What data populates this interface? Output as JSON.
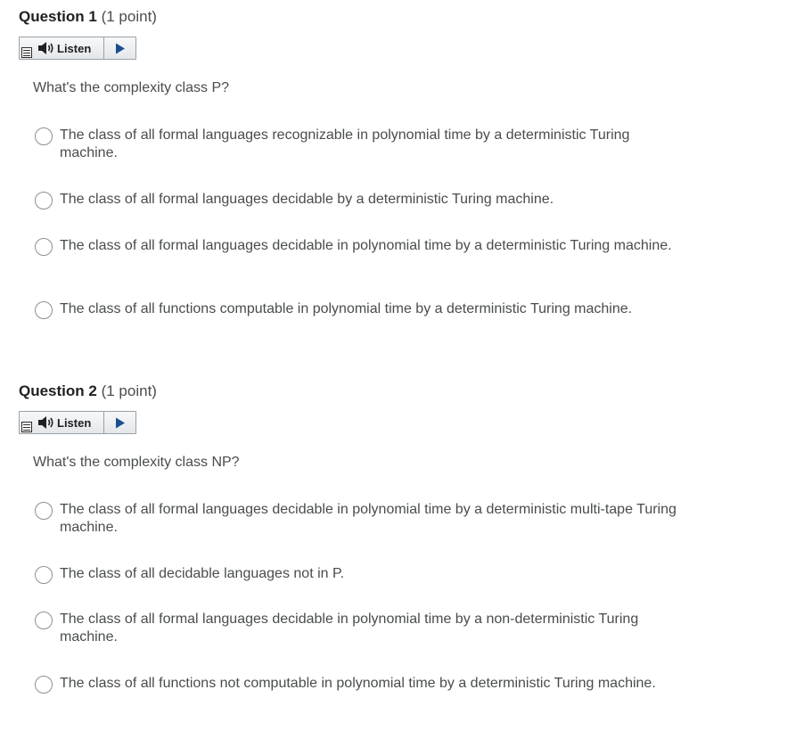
{
  "questions": [
    {
      "title": "Question 1",
      "points": "(1 point)",
      "listen_label": "Listen",
      "prompt": "What's the complexity class P?",
      "options": [
        "The class of all formal languages recognizable in polynomial time by a deterministic Turing machine.",
        "The class of all formal languages decidable by a deterministic Turing machine.",
        "The class of all formal languages decidable in polynomial time by a deterministic Turing machine.",
        "The class of all functions computable in polynomial time by a deterministic Turing machine."
      ]
    },
    {
      "title": "Question 2",
      "points": "(1 point)",
      "listen_label": "Listen",
      "prompt": "What's the complexity class NP?",
      "options": [
        "The class of all formal languages decidable in polynomial time by a deterministic multi-tape Turing machine.",
        "The class of all decidable languages not in P.",
        "The class of all formal languages decidable in polynomial time by a non-deterministic Turing machine.",
        "The class of all functions not computable in polynomial time by a deterministic Turing machine."
      ]
    }
  ]
}
